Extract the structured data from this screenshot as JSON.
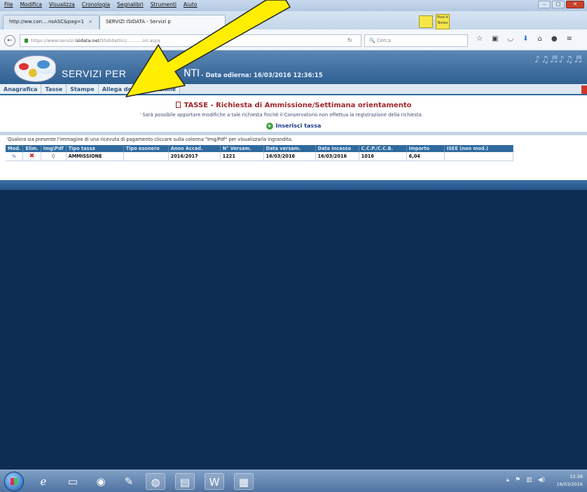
{
  "browser": {
    "menu": [
      "File",
      "Modifica",
      "Visualizza",
      "Cronologia",
      "Segnalibri",
      "Strumenti",
      "Aiuto"
    ],
    "tabs": [
      {
        "label": "http://ww.con....nsASC&pag=1"
      },
      {
        "label": "SERVIZI ISIDATA - Servizi p"
      }
    ],
    "url_prefix": "https://www.servizi.",
    "url_domain": "isidata.net",
    "url_suffix": "/SSdidattici/...........ini.aspx",
    "search_placeholder": "Cerca",
    "postit_label": "Post-it Notes"
  },
  "header": {
    "logo_text": "isidata",
    "title": "SERVIZI PER",
    "title_tail": "NTI",
    "date_label": "- Data odierna: 16/03/2016 12:36:15",
    "decoration": "♪♫♬♪♫♬"
  },
  "nav": {
    "tabs": [
      "Anagrafica",
      "Tasse",
      "Stampe",
      "Allega documentazione"
    ]
  },
  "content": {
    "title": "TASSE - Richiesta di Ammissione/Settimana orientamento",
    "note": "Sarà possibile apportare modifiche a tale richiesta finché il Conservatorio non effettua la registrazione della richiesta.",
    "add_label": "Inserisci tassa",
    "hint": "Qualora sia presente l'immagine di una ricevuta di pagamento cliccare sulla colonna \"Img/Pdf\" per visualizzarla ingrandita.",
    "table": {
      "headers": [
        "Mod.",
        "Elim.",
        "Img\\Pdf",
        "Tipo tassa",
        "Tipo esonero",
        "Anno Accad.",
        "N° Versam.",
        "Data versam.",
        "Data incasso",
        "C.C.P./C.C.B.",
        "Importo",
        "ISEE (non mod.)"
      ],
      "rows": [
        {
          "tipo": "AMMISSIONE",
          "esonero": "",
          "anno": "2016/2017",
          "nversam": "1221",
          "dataversam": "16/03/2016",
          "dataincasso": "16/03/2016",
          "ccp": "1016",
          "importo": "6,04",
          "isee": ""
        }
      ]
    }
  },
  "taskbar": {
    "time": "12:38",
    "date": "16/03/2016"
  },
  "colors": {
    "header_blue": "#2f6092",
    "title_red": "#a0262b",
    "arrow_yellow": "#ffee00",
    "dark_background": "#0d2c52"
  }
}
